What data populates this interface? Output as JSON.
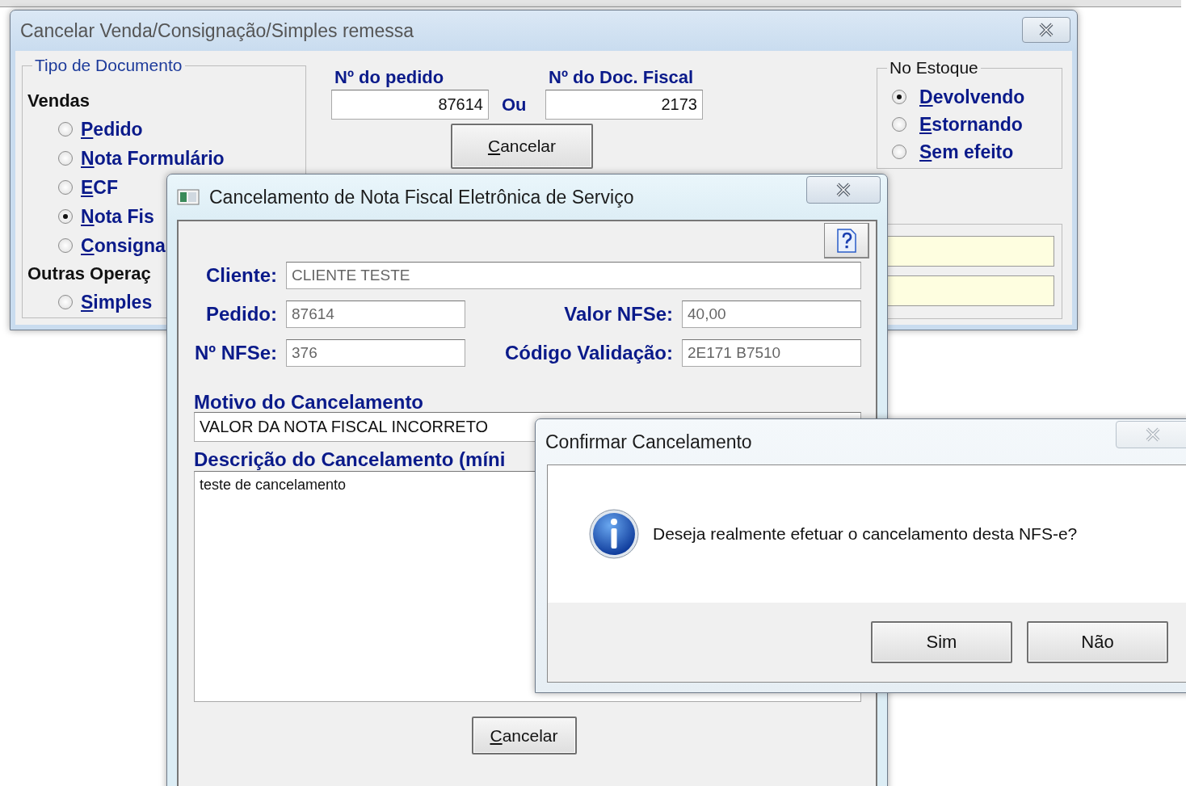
{
  "main_window": {
    "title": "Cancelar Venda/Consignação/Simples remessa",
    "close_button": {
      "disabled": false
    },
    "document_type": {
      "title": "Tipo de Documento",
      "sections": [
        {
          "heading": "Vendas",
          "options": [
            {
              "label": "Pedido",
              "selected": false
            },
            {
              "label": "Nota Formulário",
              "selected": false
            },
            {
              "label": "ECF",
              "selected": false
            },
            {
              "label": "Nota Fis",
              "selected": true
            },
            {
              "label": "Consigna",
              "selected": false
            }
          ]
        },
        {
          "heading": "Outras Operaç",
          "options": [
            {
              "label": "Simples",
              "selected": false
            }
          ]
        }
      ]
    },
    "order_number": {
      "label": "Nº do pedido",
      "value": "87614"
    },
    "separator": "Ou",
    "fiscal_doc_number": {
      "label": "Nº do Doc. Fiscal",
      "value": "2173"
    },
    "cancel_button": "Cancelar",
    "stock": {
      "title": "No Estoque",
      "options": [
        {
          "label": "Devolvendo",
          "selected": true
        },
        {
          "label": "Estornando",
          "selected": false
        },
        {
          "label": "Sem efeito",
          "selected": false
        }
      ]
    }
  },
  "nfse_dialog": {
    "title": "Cancelamento de Nota Fiscal Eletrônica de Serviço",
    "close_button": {
      "disabled": false
    },
    "fields": [
      {
        "label": "Cliente:",
        "value": "CLIENTE TESTE",
        "disabled": true
      },
      {
        "label": "Pedido:",
        "value": "87614",
        "disabled": true
      },
      {
        "label": "Valor NFSe:",
        "value": "40,00",
        "disabled": true
      },
      {
        "label": "Nº NFSe:",
        "value": "376",
        "disabled": true
      },
      {
        "label": "Código Validação:",
        "value": "2E171 B7510",
        "disabled": true
      }
    ],
    "reason": {
      "label": "Motivo do Cancelamento",
      "value": "VALOR DA NOTA FISCAL INCORRETO"
    },
    "description": {
      "label": "Descrição do Cancelamento (míni",
      "value": "teste de cancelamento"
    },
    "cancel_button": "Cancelar"
  },
  "confirm_dialog": {
    "title": "Confirmar Cancelamento",
    "close_button": {
      "disabled": true
    },
    "message": "Deseja realmente efetuar o cancelamento desta NFS-e?",
    "buttons": [
      "Sim",
      "Não"
    ]
  }
}
